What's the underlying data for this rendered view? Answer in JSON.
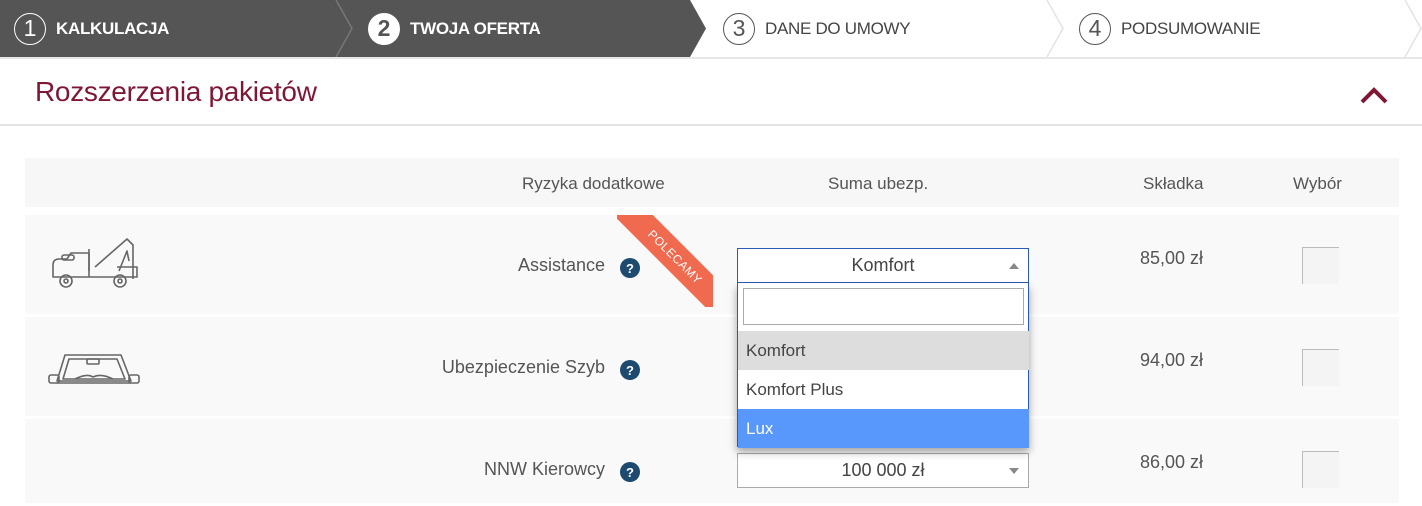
{
  "stepper": {
    "steps": [
      {
        "number": "1",
        "label": "KALKULACJA",
        "state": "done"
      },
      {
        "number": "2",
        "label": "TWOJA OFERTA",
        "state": "active"
      },
      {
        "number": "3",
        "label": "DANE DO UMOWY",
        "state": "upcoming"
      },
      {
        "number": "4",
        "label": "PODSUMOWANIE",
        "state": "upcoming"
      }
    ]
  },
  "section": {
    "title": "Rozszerzenia pakietów",
    "collapse_icon": "chevron-up-icon",
    "accent_color": "#7f1734"
  },
  "table": {
    "headers": {
      "risks": "Ryzyka dodatkowe",
      "sum": "Suma ubezp.",
      "premium": "Składka",
      "choice": "Wybór"
    },
    "rows": [
      {
        "icon": "tow-truck-icon",
        "name": "Assistance",
        "badge": "POLECAMY",
        "sum_value": "Komfort",
        "premium": "85,00  zł",
        "selected": false
      },
      {
        "icon": "windshield-icon",
        "name": "Ubezpieczenie Szyb",
        "sum_value": "",
        "premium": "94,00  zł",
        "selected": false
      },
      {
        "icon": "",
        "name": "NNW Kierowcy",
        "sum_value": "100 000 zł",
        "premium": "86,00  zł",
        "selected": false
      }
    ]
  },
  "dropdown": {
    "search_value": "",
    "options": [
      "Komfort",
      "Komfort Plus",
      "Lux"
    ],
    "highlighted": "Komfort",
    "hovered": "Lux",
    "hover_color": "#5897fb"
  },
  "help_label": "?"
}
